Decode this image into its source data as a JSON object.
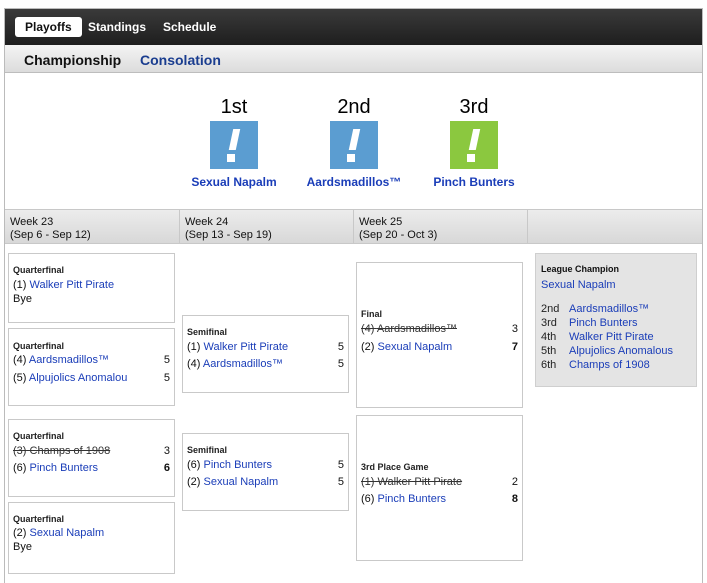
{
  "nav": {
    "tabs": [
      "Playoffs",
      "Standings",
      "Schedule"
    ]
  },
  "subnav": {
    "tabs": [
      "Championship",
      "Consolation"
    ]
  },
  "podium": [
    {
      "place": "1st",
      "team": "Sexual Napalm",
      "color": "#5b9dd1"
    },
    {
      "place": "2nd",
      "team": "Aardsmadillos™",
      "color": "#5b9dd1"
    },
    {
      "place": "3rd",
      "team": "Pinch Bunters",
      "color": "#8bc83f"
    }
  ],
  "weeks": [
    {
      "name": "Week 23",
      "range": "(Sep 6 - Sep 12)"
    },
    {
      "name": "Week 24",
      "range": "(Sep 13 - Sep 19)"
    },
    {
      "name": "Week 25",
      "range": "(Sep 20 - Oct 3)"
    }
  ],
  "matchups": {
    "qf1": {
      "round": "Quarterfinal",
      "teams": [
        {
          "seed": "(1)",
          "name": "Walker Pitt Pirate"
        }
      ],
      "bye": "Bye"
    },
    "qf2": {
      "round": "Quarterfinal",
      "teams": [
        {
          "seed": "(4)",
          "name": "Aardsmadillos™",
          "score": "5"
        },
        {
          "seed": "(5)",
          "name": "Alpujolics Anomalou",
          "score": "5"
        }
      ]
    },
    "qf3": {
      "round": "Quarterfinal",
      "teams": [
        {
          "seed": "(3)",
          "name": "Champs of 1908",
          "score": "3"
        },
        {
          "seed": "(6)",
          "name": "Pinch Bunters",
          "score": "6"
        }
      ]
    },
    "qf4": {
      "round": "Quarterfinal",
      "teams": [
        {
          "seed": "(2)",
          "name": "Sexual Napalm"
        }
      ],
      "bye": "Bye"
    },
    "sf1": {
      "round": "Semifinal",
      "teams": [
        {
          "seed": "(1)",
          "name": "Walker Pitt Pirate",
          "score": "5"
        },
        {
          "seed": "(4)",
          "name": "Aardsmadillos™",
          "score": "5"
        }
      ]
    },
    "sf2": {
      "round": "Semifinal",
      "teams": [
        {
          "seed": "(6)",
          "name": "Pinch Bunters",
          "score": "5"
        },
        {
          "seed": "(2)",
          "name": "Sexual Napalm",
          "score": "5"
        }
      ]
    },
    "final": {
      "round": "Final",
      "teams": [
        {
          "seed": "(4)",
          "name": "Aardsmadillos™",
          "score": "3"
        },
        {
          "seed": "(2)",
          "name": "Sexual Napalm",
          "score": "7"
        }
      ]
    },
    "third": {
      "round": "3rd Place Game",
      "teams": [
        {
          "seed": "(1)",
          "name": "Walker Pitt Pirate",
          "score": "2"
        },
        {
          "seed": "(6)",
          "name": "Pinch Bunters",
          "score": "8"
        }
      ]
    }
  },
  "champion": {
    "title": "League Champion",
    "name": "Sexual Napalm",
    "standings": [
      {
        "place": "2nd",
        "team": "Aardsmadillos™"
      },
      {
        "place": "3rd",
        "team": "Pinch Bunters"
      },
      {
        "place": "4th",
        "team": "Walker Pitt Pirate"
      },
      {
        "place": "5th",
        "team": "Alpujolics Anomalous"
      },
      {
        "place": "6th",
        "team": "Champs of 1908"
      }
    ]
  }
}
